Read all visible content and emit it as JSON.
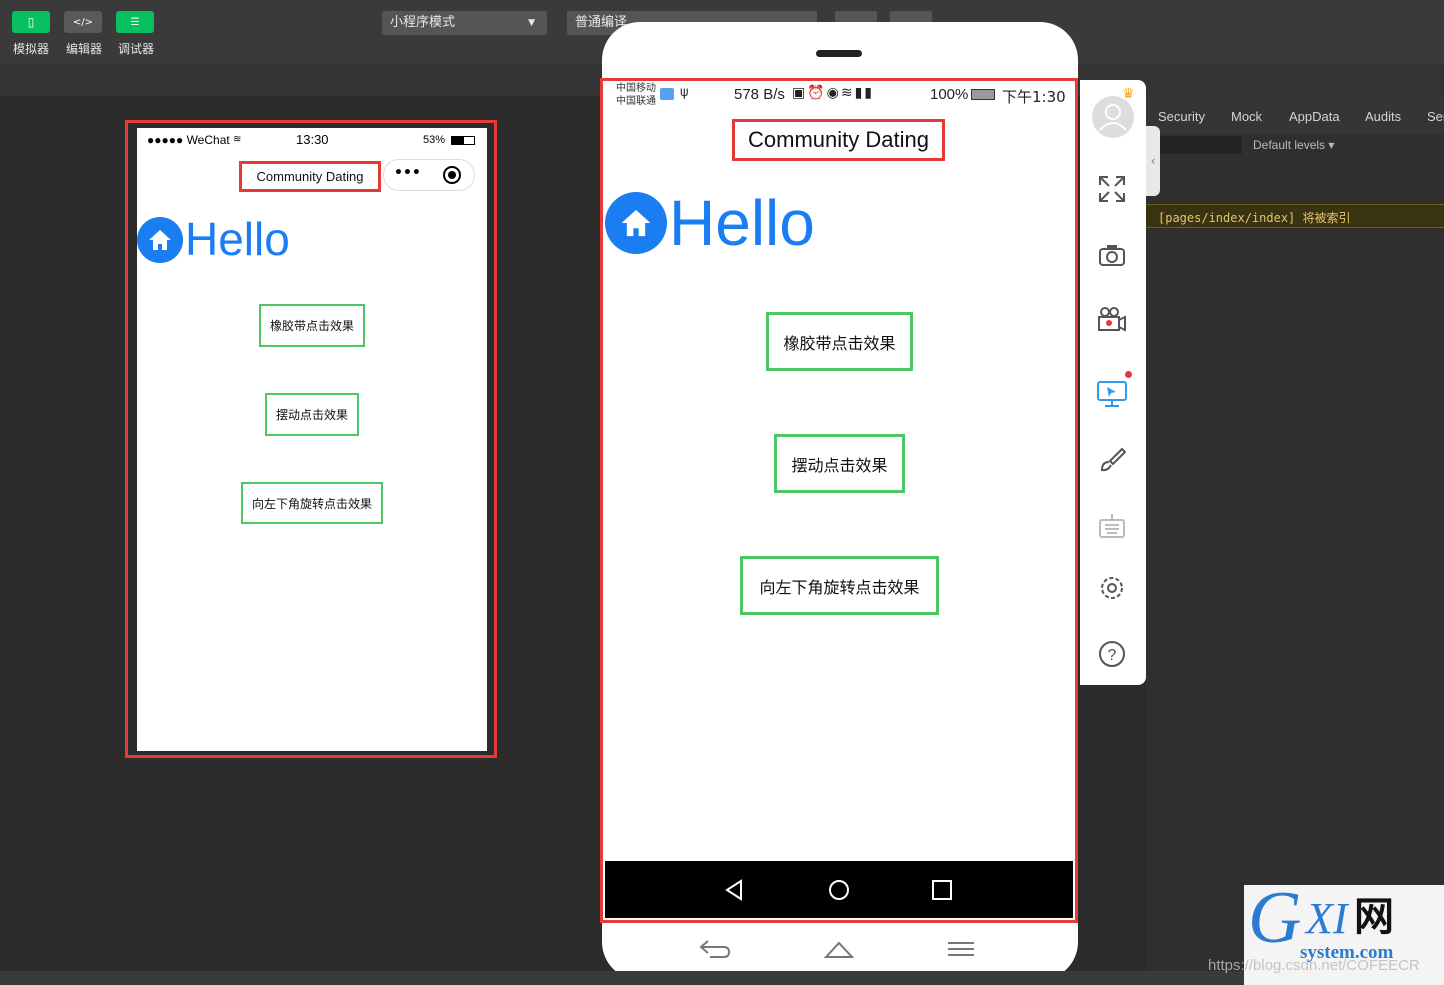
{
  "toolbar": {
    "buttons": [
      {
        "label": "模拟器",
        "color": "#07c160"
      },
      {
        "label": "编辑器",
        "color": "#5a5a5a"
      },
      {
        "label": "调试器",
        "color": "#07c160"
      }
    ],
    "mode_select": "小程序模式",
    "compile_select": "普通编译"
  },
  "simulator": {
    "status": {
      "signal": "●●●●● WeChat",
      "time": "13:30",
      "battery": "53%"
    },
    "nav_title": "Community Dating",
    "hello": "Hello",
    "buttons": [
      "橡胶带点击效果",
      "摆动点击效果",
      "向左下角旋转点击效果"
    ]
  },
  "phone": {
    "status_left": [
      "中国移动",
      "中国联通"
    ],
    "status_right": "578 B/s",
    "status_battery": "100%",
    "status_time": "下午1:30",
    "nav_title": "Community Dating",
    "hello": "Hello",
    "buttons": [
      "橡胶带点击效果",
      "摆动点击效果",
      "向左下角旋转点击效果"
    ]
  },
  "devtools": {
    "tabs": [
      "Security",
      "Mock",
      "AppData",
      "Audits",
      "Ser"
    ],
    "levels": "Default levels ▾",
    "warning": "[pages/index/index] 将被索引"
  },
  "watermark": {
    "brand": "GXI网",
    "site": "system.com",
    "url": "https://blog.csdn.net/COFEECR"
  },
  "colors": {
    "accent_blue": "#1a7ef2",
    "frame_red": "#e83a3a",
    "button_green": "#4cc764",
    "wechat_green": "#07c160"
  }
}
